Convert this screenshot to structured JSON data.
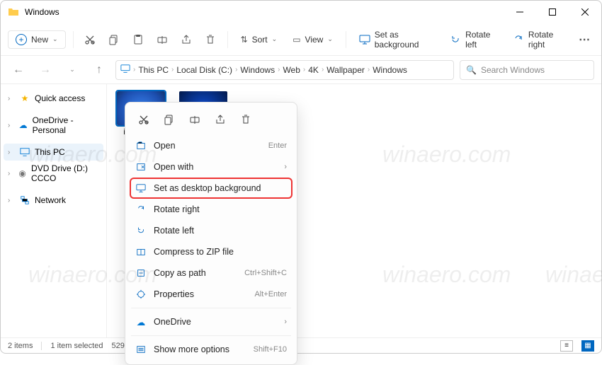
{
  "titlebar": {
    "title": "Windows"
  },
  "toolbar": {
    "new_label": "New",
    "sort_label": "Sort",
    "view_label": "View",
    "set_bg_label": "Set as background",
    "rotate_left_label": "Rotate left",
    "rotate_right_label": "Rotate right"
  },
  "breadcrumb": {
    "items": [
      "This PC",
      "Local Disk (C:)",
      "Windows",
      "Web",
      "4K",
      "Wallpaper",
      "Windows"
    ]
  },
  "search": {
    "placeholder": "Search Windows"
  },
  "sidebar": {
    "items": [
      {
        "label": "Quick access",
        "icon": "star",
        "color": "#f5b400"
      },
      {
        "label": "OneDrive - Personal",
        "icon": "cloud",
        "color": "#0078d4"
      },
      {
        "label": "This PC",
        "icon": "pc",
        "color": "#0078d4",
        "selected": true
      },
      {
        "label": "DVD Drive (D:) CCCO",
        "icon": "disc",
        "color": "#777"
      },
      {
        "label": "Network",
        "icon": "network",
        "color": "#0078d4"
      }
    ]
  },
  "files": [
    {
      "name": "img0_19...",
      "selected": true,
      "thumb": "blue1"
    },
    {
      "name": "",
      "selected": false,
      "thumb": "blue2"
    }
  ],
  "context_menu": {
    "items": [
      {
        "label": "Open",
        "accel": "Enter",
        "icon": "open"
      },
      {
        "label": "Open with",
        "submenu": true,
        "icon": "openwith"
      },
      {
        "label": "Set as desktop background",
        "icon": "desktop",
        "highlight": true
      },
      {
        "label": "Rotate right",
        "icon": "rotr"
      },
      {
        "label": "Rotate left",
        "icon": "rotl"
      },
      {
        "label": "Compress to ZIP file",
        "icon": "zip"
      },
      {
        "label": "Copy as path",
        "accel": "Ctrl+Shift+C",
        "icon": "path"
      },
      {
        "label": "Properties",
        "accel": "Alt+Enter",
        "icon": "props"
      }
    ],
    "onedrive_label": "OneDrive",
    "more_label": "Show more options",
    "more_accel": "Shift+F10"
  },
  "statusbar": {
    "count": "2 items",
    "selection": "1 item selected",
    "size": "529 KB"
  },
  "watermark": "winaero.com"
}
